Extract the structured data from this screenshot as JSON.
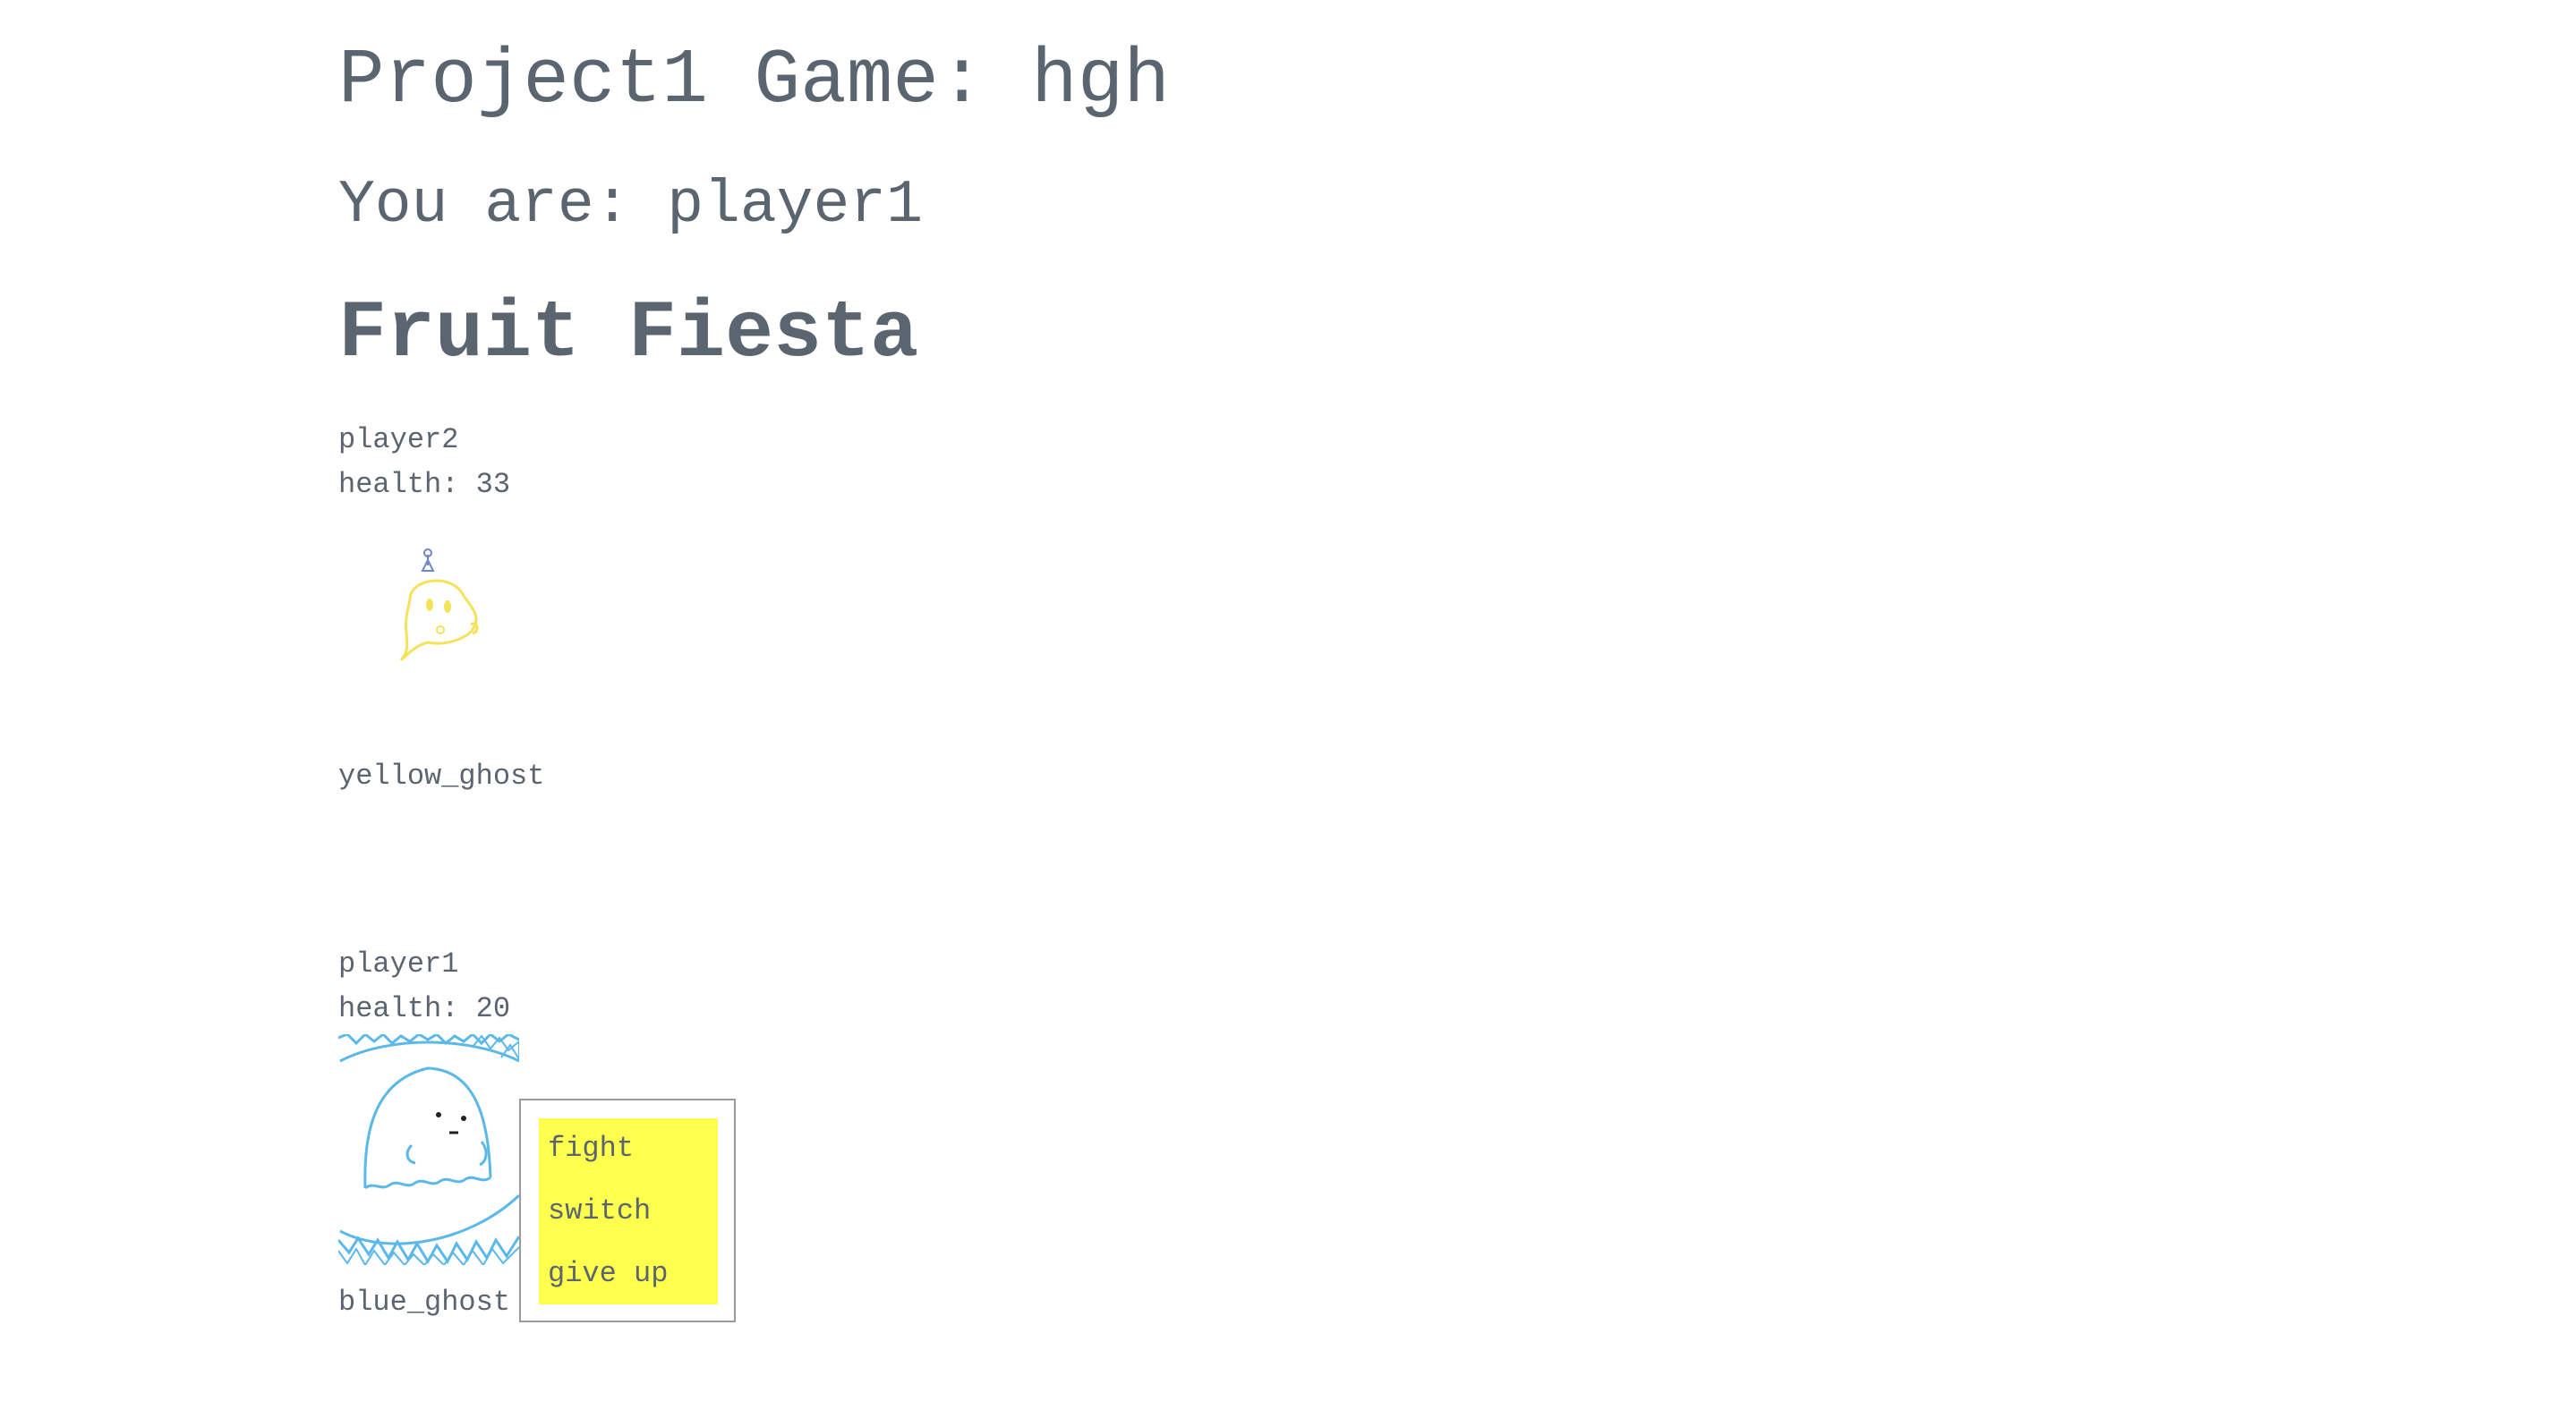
{
  "header": {
    "title": "Project1 Game: hgh",
    "you_are": "You are: player1",
    "game_name": "Fruit Fiesta"
  },
  "opponent": {
    "name": "player2",
    "health": "health: 33",
    "monster": "yellow_ghost",
    "sprite_icon": "yellow-ghost-sprite",
    "color": "#f2e35a"
  },
  "me": {
    "name": "player1",
    "health": "health: 20",
    "monster": "blue_ghost",
    "sprite_icon": "blue-ghost-sprite",
    "color": "#5bb8ea"
  },
  "menu": {
    "items": [
      "fight",
      "switch",
      "give up"
    ],
    "background": "#ffff4d"
  }
}
